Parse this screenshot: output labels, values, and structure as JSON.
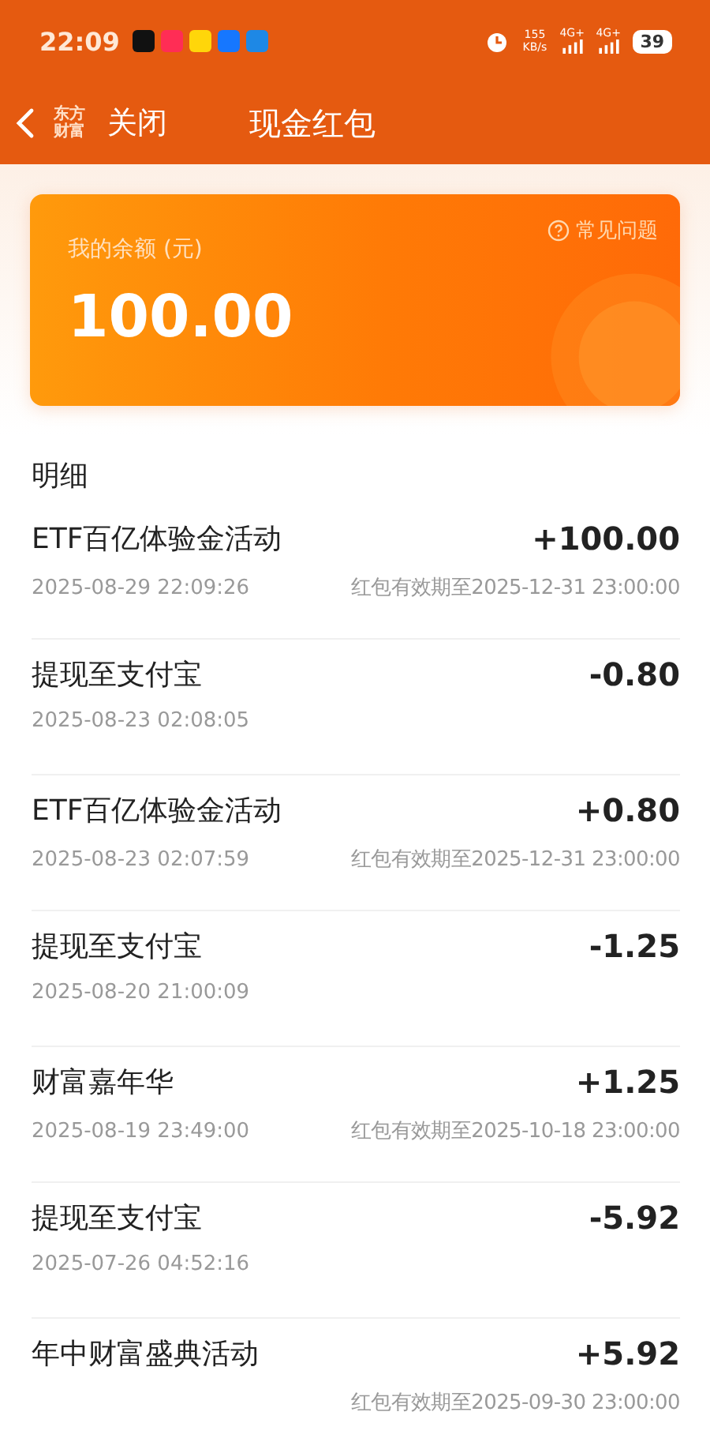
{
  "status_bar": {
    "time": "22:09",
    "net_speed": "155",
    "net_unit": "KB/s",
    "sim1": "4G+",
    "sim2": "4G+",
    "battery": "39"
  },
  "header": {
    "logo_top": "东方",
    "logo_bottom": "财富",
    "close": "关闭",
    "title": "现金红包"
  },
  "balance": {
    "label": "我的余额 (元)",
    "amount": "100.00",
    "faq": "常见问题"
  },
  "section_title": "明细",
  "records": [
    {
      "title": "ETF百亿体验金活动",
      "amount": "+100.00",
      "time": "2025-08-29 22:09:26",
      "note": "红包有效期至2025-12-31 23:00:00"
    },
    {
      "title": "提现至支付宝",
      "amount": "-0.80",
      "time": "2025-08-23 02:08:05"
    },
    {
      "title": "ETF百亿体验金活动",
      "amount": "+0.80",
      "time": "2025-08-23 02:07:59",
      "note": "红包有效期至2025-12-31 23:00:00"
    },
    {
      "title": "提现至支付宝",
      "amount": "-1.25",
      "time": "2025-08-20 21:00:09"
    },
    {
      "title": "财富嘉年华",
      "amount": "+1.25",
      "time": "2025-08-19 23:49:00",
      "note": "红包有效期至2025-10-18 23:00:00"
    },
    {
      "title": "提现至支付宝",
      "amount": "-5.92",
      "time": "2025-07-26 04:52:16"
    },
    {
      "title": "年中财富盛典活动",
      "amount": "+5.92",
      "note": "红包有效期至2025-09-30 23:00:00"
    }
  ]
}
